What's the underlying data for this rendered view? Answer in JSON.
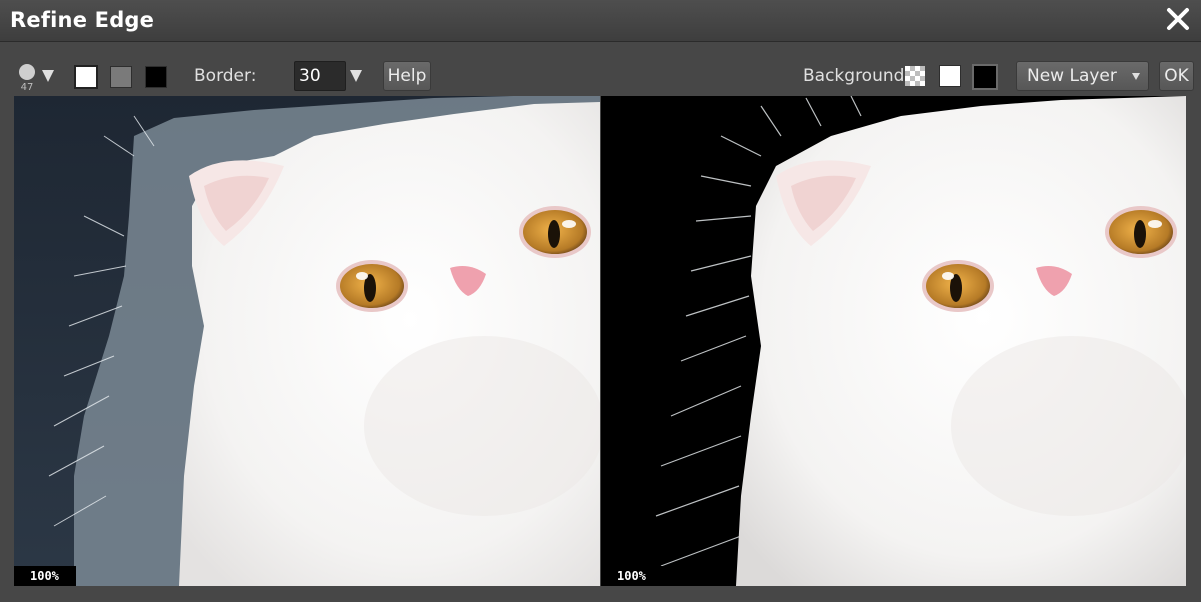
{
  "window": {
    "title": "Refine Edge"
  },
  "toolbar": {
    "brush_size": "47",
    "border_label": "Border:",
    "border_value": "30",
    "help_label": "Help",
    "background_label": "Background:",
    "layer_select_value": "New Layer",
    "ok_label": "OK"
  },
  "panels": {
    "left_zoom": "100%",
    "right_zoom": "100%"
  },
  "colors": {
    "dialog_bg": "#474747",
    "left_backdrop": "#24303c",
    "right_backdrop": "#000000"
  }
}
